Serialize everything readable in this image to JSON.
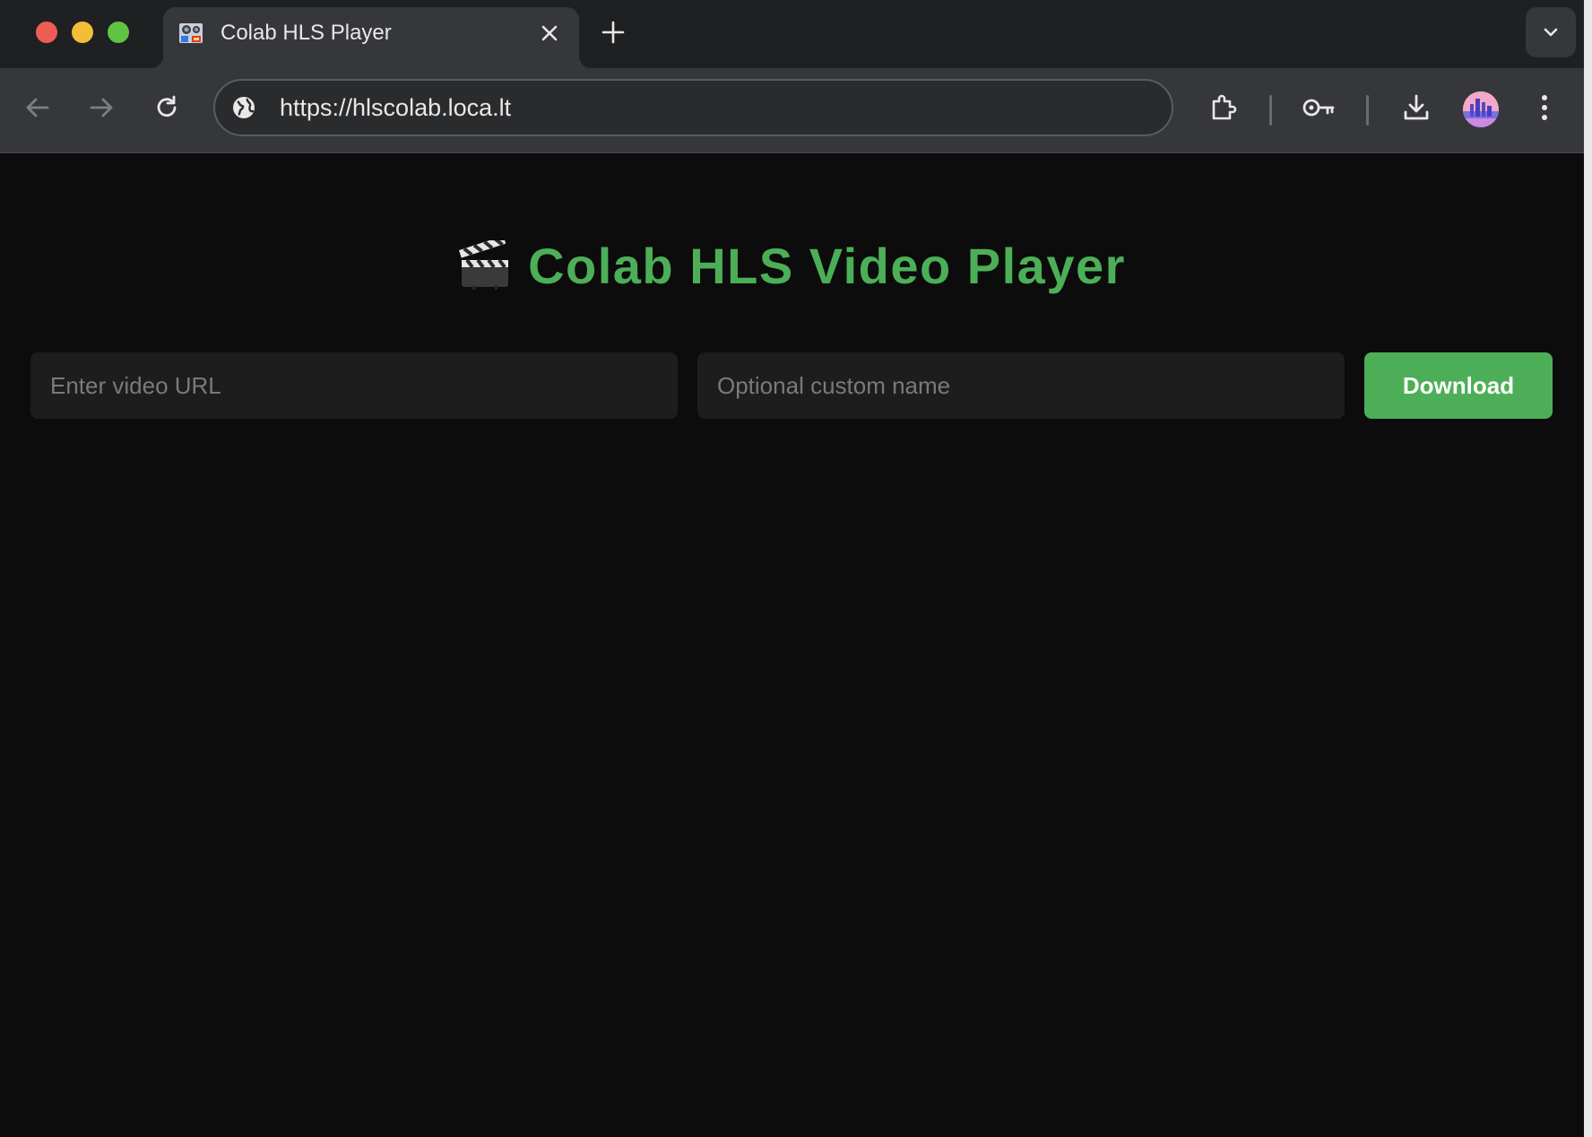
{
  "browser": {
    "tab": {
      "title": "Colab HLS Player",
      "favicon": "film-camera-icon"
    },
    "new_tab_icon": "plus-icon",
    "tab_search_icon": "chevron-down-icon",
    "address_bar": {
      "url": "https://hlscolab.loca.lt",
      "site_info_icon": "globe-icon"
    },
    "toolbar_icons": [
      "back-arrow-icon",
      "forward-arrow-icon",
      "reload-icon",
      "extensions-icon",
      "password-key-icon",
      "download-icon",
      "avatar",
      "more-menu-icon"
    ]
  },
  "page": {
    "heading": "Colab HLS Video Player",
    "heading_icon": "clapperboard-icon",
    "url_input": {
      "placeholder": "Enter video URL",
      "value": ""
    },
    "name_input": {
      "placeholder": "Optional custom name",
      "value": ""
    },
    "download_button": "Download"
  },
  "colors": {
    "accent": "#4caf57",
    "page_background": "#0c0c0c",
    "input_background": "#1d1d1d",
    "toolbar_background": "#36373a",
    "tabstrip_background": "#1f2022"
  }
}
